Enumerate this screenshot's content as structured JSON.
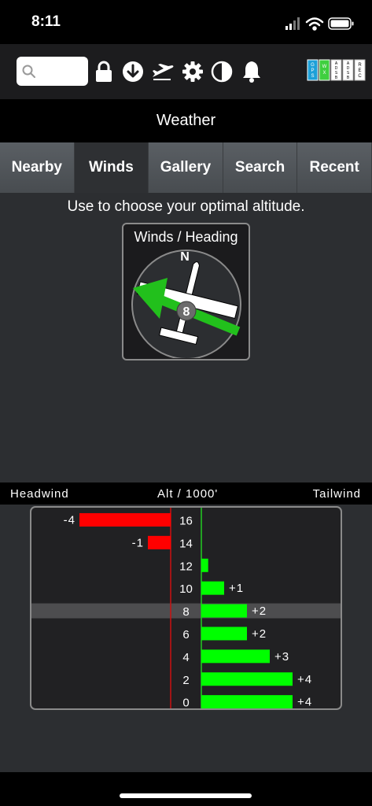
{
  "status_bar": {
    "time": "8:11"
  },
  "toolbar": {
    "search_placeholder": "",
    "icons": [
      "search-icon",
      "lock-icon",
      "download-icon",
      "plane-icon",
      "gear-icon",
      "contrast-icon",
      "bell-icon"
    ],
    "status_indicators": [
      "GPS",
      "WX",
      "ADSB",
      "ADSB",
      "REC"
    ]
  },
  "title": "Weather",
  "tabs": [
    {
      "label": "Nearby",
      "active": false
    },
    {
      "label": "Winds",
      "active": true
    },
    {
      "label": "Gallery",
      "active": false
    },
    {
      "label": "Search",
      "active": false
    },
    {
      "label": "Recent",
      "active": false
    }
  ],
  "hint": "Use to choose your optimal altitude.",
  "wind_widget": {
    "label": "Winds / Heading",
    "north": "N",
    "speed": "8"
  },
  "axis_header": {
    "left": "Headwind",
    "center": "Alt / 1000'",
    "right": "Tailwind"
  },
  "colors": {
    "headwind": "#ff0000",
    "tailwind": "#00ff00",
    "arrow": "#22c01c"
  },
  "chart_data": {
    "type": "bar",
    "categories": [
      "16",
      "14",
      "12",
      "10",
      "8",
      "6",
      "4",
      "2",
      "0"
    ],
    "values": [
      -4,
      -1,
      0.3,
      1,
      2,
      2,
      3,
      4,
      4
    ],
    "value_labels": [
      "-4",
      "-1",
      "",
      "+1",
      "+2",
      "+2",
      "+3",
      "+4",
      "+4"
    ],
    "highlight_band": "7",
    "xlabel": "",
    "ylabel": "Alt / 1000'"
  }
}
